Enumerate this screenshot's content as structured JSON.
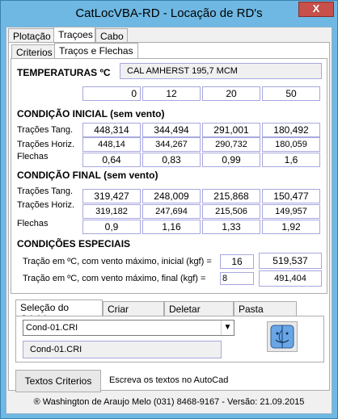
{
  "window": {
    "title": "CatLocVBA-RD - Locação de RD's",
    "close_glyph": "X"
  },
  "main_tabs": [
    "Plotação",
    "Traçoes",
    "Cabo"
  ],
  "sub_tabs": [
    "Criterios",
    "Traços e Flechas"
  ],
  "temperaturas": {
    "label": "TEMPERATURAS ºC",
    "cable": "CAL AMHERST 195,7 MCM",
    "values": [
      "0",
      "12",
      "20",
      "50"
    ]
  },
  "cond_inicial": {
    "title": "CONDIÇÃO INICIAL (sem vento)",
    "rows": [
      {
        "label": "Trações Tang.",
        "values": [
          "448,314",
          "344,494",
          "291,001",
          "180,492"
        ]
      },
      {
        "label": "Trações Horiz.",
        "values": [
          "448,14",
          "344,267",
          "290,732",
          "180,059"
        ]
      },
      {
        "label": "Flechas",
        "values": [
          "0,64",
          "0,83",
          "0,99",
          "1,6"
        ]
      }
    ]
  },
  "cond_final": {
    "title": "CONDIÇÃO FINAL (sem vento)",
    "rows": [
      {
        "label": "Trações Tang.",
        "values": [
          "319,427",
          "248,009",
          "215,868",
          "150,477"
        ]
      },
      {
        "label": "Trações Horiz.",
        "values": [
          "319,182",
          "247,694",
          "215,506",
          "149,957"
        ]
      },
      {
        "label": "Flechas",
        "values": [
          "0,9",
          "1,16",
          "1,33",
          "1,92"
        ]
      }
    ]
  },
  "especiais": {
    "title": "CONDIÇÕES ESPECIAIS",
    "inicial_label": "Tração em ºC, com vento máximo, inicial (kgf) =",
    "inicial_temp": "16",
    "inicial_value": "519,537",
    "final_label": "Tração em ºC, com vento máximo, final (kgf) =",
    "final_temp": "8",
    "final_value": "491,404"
  },
  "criterio_tabs": [
    "Seleção do Critério",
    "Criar Critério",
    "Deletar Critério",
    "Pasta Projeto"
  ],
  "criterio": {
    "select_value": "Cond-01.CRI",
    "selected_display": "Cond-01.CRI",
    "finder_icon": "finder-icon"
  },
  "textos": {
    "button_label": "Textos Criterios",
    "description": "Escreva os textos no AutoCad"
  },
  "footer": "® Washington de Araujo Melo (031) 8468-9167 - Versão: 21.09.2015"
}
